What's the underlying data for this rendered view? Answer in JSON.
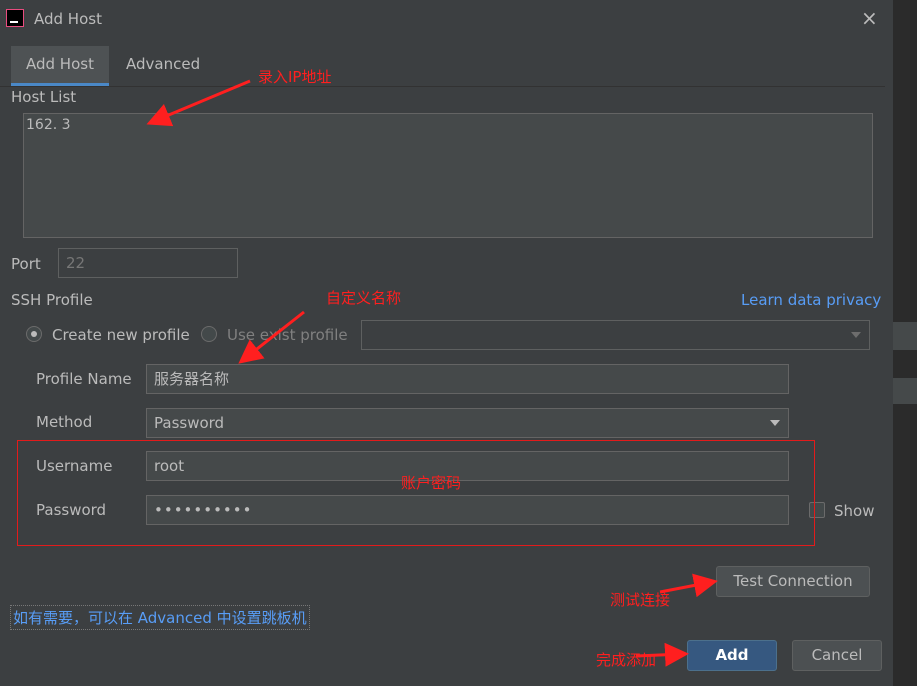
{
  "window": {
    "title": "Add Host",
    "close_icon": "×"
  },
  "tabs": [
    {
      "label": "Add Host",
      "active": true
    },
    {
      "label": "Advanced",
      "active": false
    }
  ],
  "host_list": {
    "label": "Host List",
    "value": "162.        3"
  },
  "port": {
    "label": "Port",
    "placeholder": "22"
  },
  "ssh_profile": {
    "label": "SSH Profile",
    "learn_link": "Learn data privacy",
    "create_new_label": "Create new profile",
    "use_exist_label": "Use exist profile",
    "selected": "create_new"
  },
  "form": {
    "profile_name_label": "Profile Name",
    "profile_name_value": "服务器名称",
    "method_label": "Method",
    "method_value": "Password",
    "username_label": "Username",
    "username_value": "root",
    "password_label": "Password",
    "password_value": "••••••••••",
    "show_label": "Show"
  },
  "buttons": {
    "test_connection": "Test Connection",
    "add": "Add",
    "cancel": "Cancel"
  },
  "hint_text": "如有需要，可以在 Advanced 中设置跳板机",
  "annotations": {
    "ip": "录入IP地址",
    "name": "自定义名称",
    "account": "账户密码",
    "test": "测试连接",
    "done": "完成添加"
  },
  "colors": {
    "annotation": "#ff1f1f",
    "accent": "#4a88c7",
    "link": "#589df6",
    "background": "#3c3f41"
  }
}
